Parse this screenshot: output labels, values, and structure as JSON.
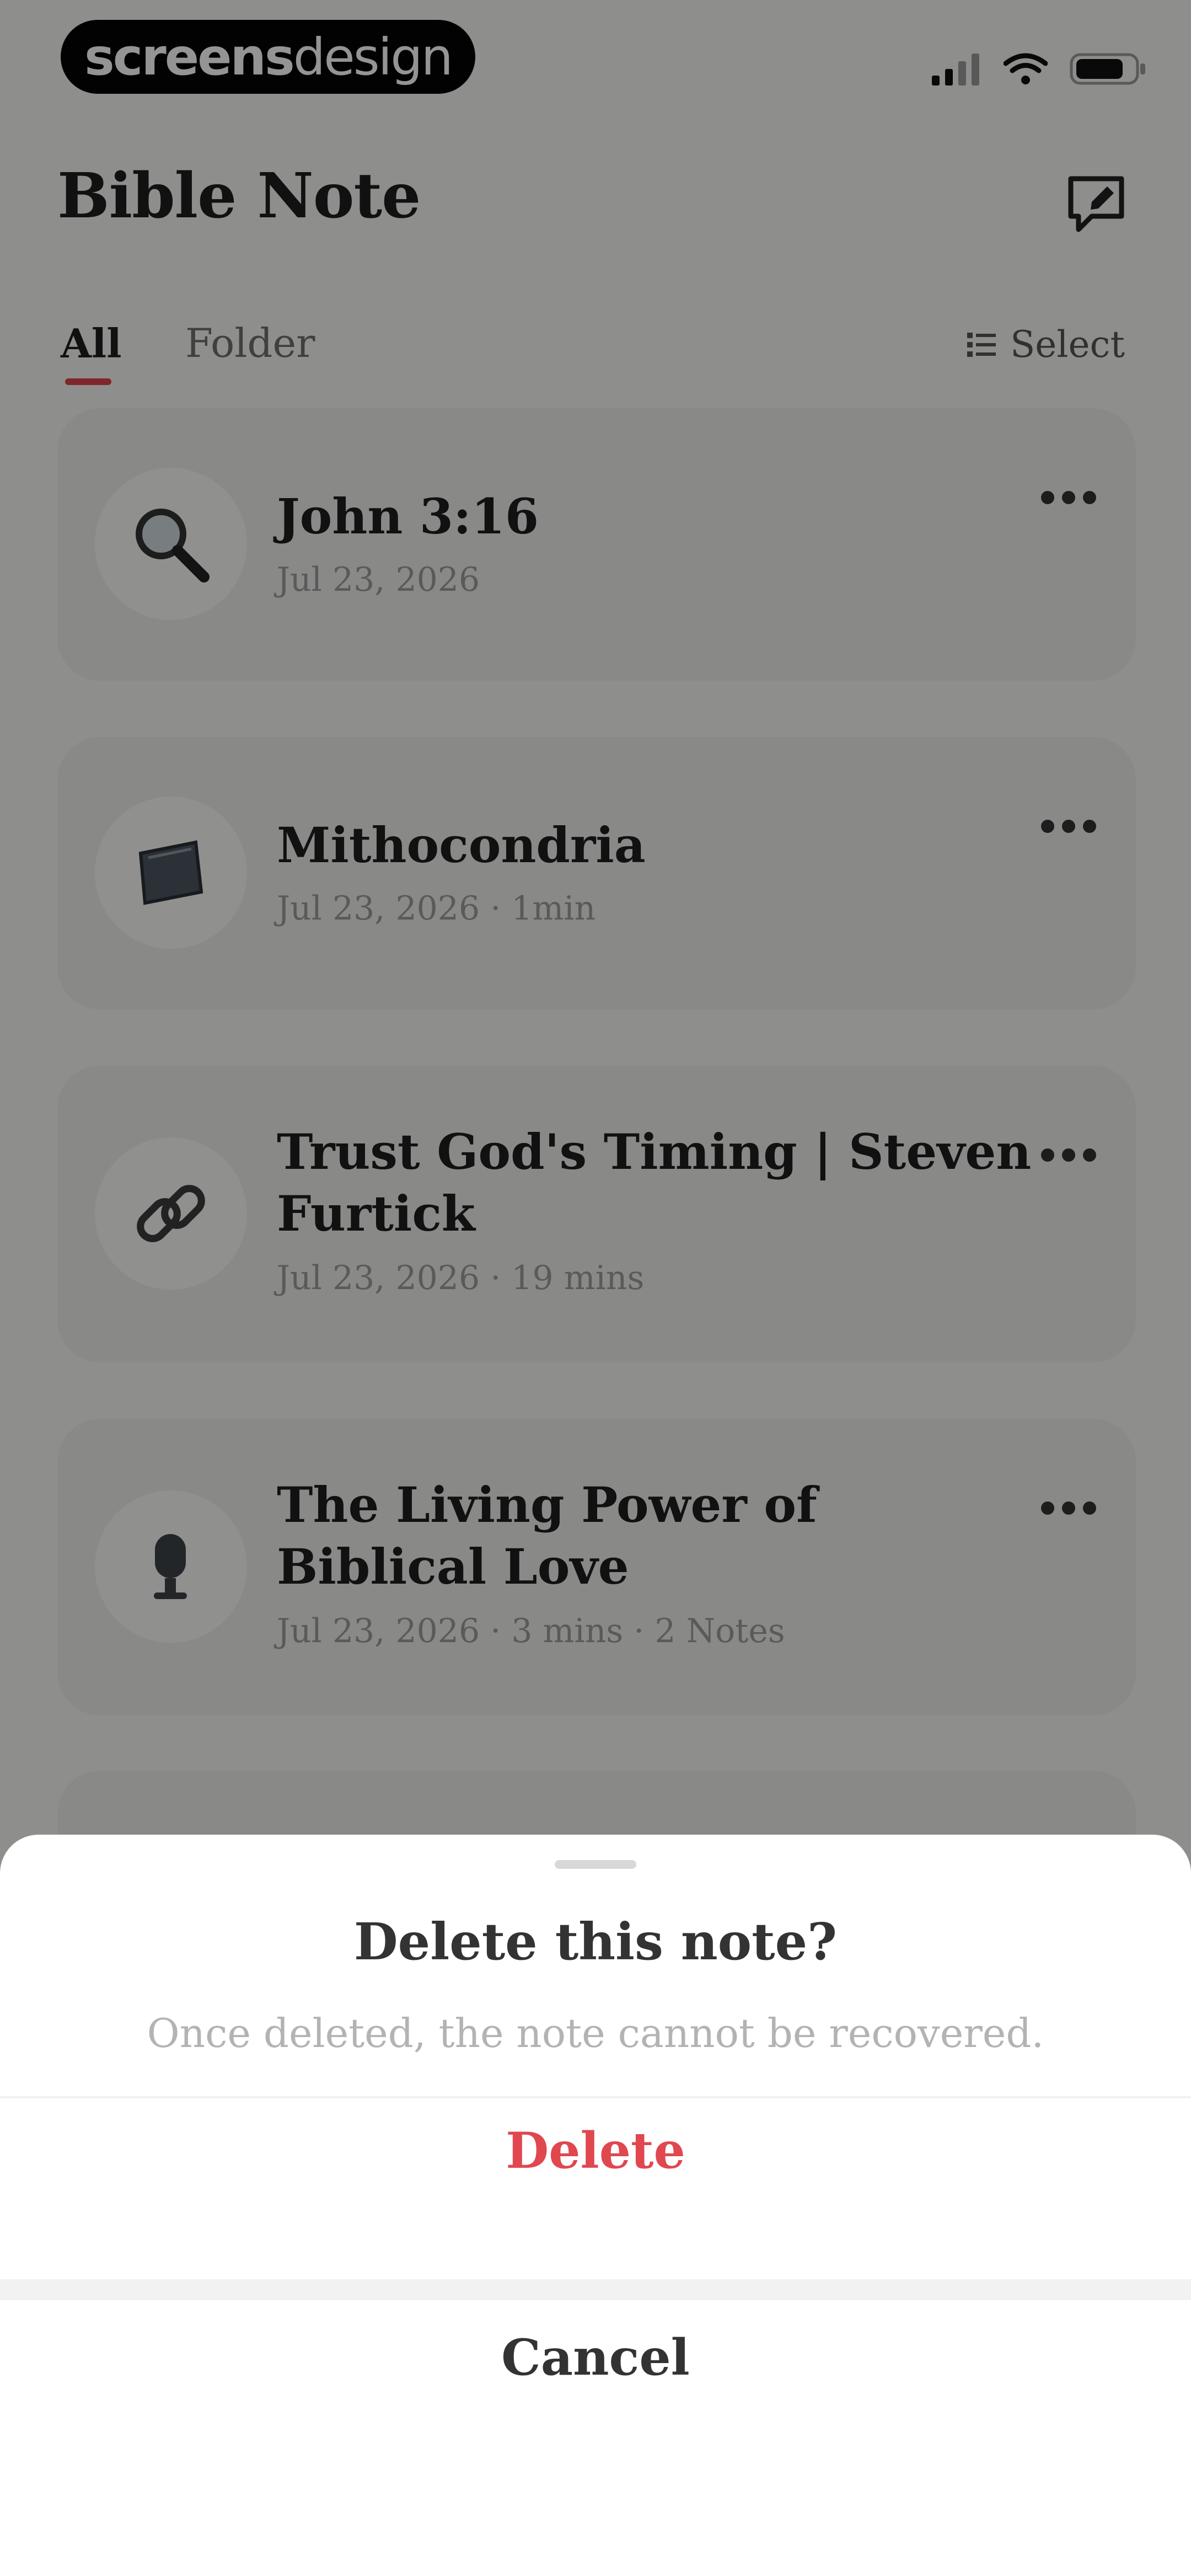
{
  "status_bar": {
    "logo_bold": "screens",
    "logo_light": "design"
  },
  "header": {
    "title": "Bible Note"
  },
  "tabs": [
    {
      "label": "All",
      "active": true
    },
    {
      "label": "Folder",
      "active": false
    }
  ],
  "select_label": "Select",
  "notes": [
    {
      "title": "John 3:16",
      "meta": "Jul 23, 2026",
      "icon": "magnifier-icon"
    },
    {
      "title": "Mithocondria",
      "meta": "Jul 23, 2026 · 1min",
      "icon": "notebook-icon"
    },
    {
      "title": "Trust God's Timing | Steven Furtick",
      "meta": "Jul 23, 2026 · 19 mins",
      "icon": "link-icon"
    },
    {
      "title": "The Living Power of Biblical Love",
      "meta": "Jul 23, 2026 · 3 mins · 2 Notes",
      "icon": "microphone-icon"
    }
  ],
  "dialog": {
    "title": "Delete this note?",
    "message": "Once deleted, the note cannot be recovered.",
    "delete_label": "Delete",
    "cancel_label": "Cancel"
  },
  "colors": {
    "accent": "#e0474f",
    "card": "#ececea",
    "background": "#f5f4f1"
  }
}
